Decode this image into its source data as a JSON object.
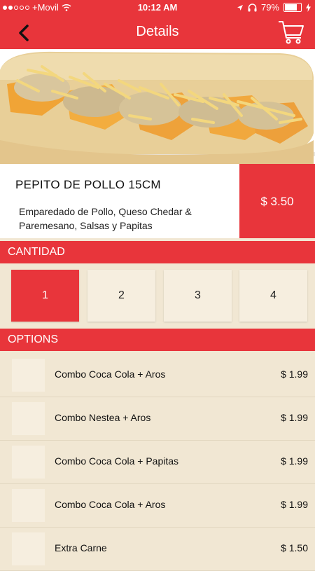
{
  "status_bar": {
    "carrier": "+Movil",
    "time": "10:12 AM",
    "battery": "79%",
    "battery_level": 0.79
  },
  "nav": {
    "title": "Details",
    "back_icon": "chevron-left-icon",
    "cart_icon": "cart-icon"
  },
  "product": {
    "name": "PEPITO DE POLLO 15CM",
    "description": "Emparedado de Pollo, Queso Chedar & Paremesano, Salsas y Papitas",
    "price": "$ 3.50"
  },
  "quantity": {
    "header": "CANTIDAD",
    "options": [
      "1",
      "2",
      "3",
      "4"
    ],
    "selected": "1"
  },
  "options_section": {
    "header": "OPTIONS",
    "items": [
      {
        "name": "Combo Coca Cola + Aros",
        "price": "$ 1.99"
      },
      {
        "name": "Combo Nestea + Aros",
        "price": "$ 1.99"
      },
      {
        "name": "Combo Coca Cola + Papitas",
        "price": "$ 1.99"
      },
      {
        "name": "Combo Coca Cola + Aros",
        "price": "$ 1.99"
      },
      {
        "name": "Extra Carne",
        "price": "$ 1.50"
      }
    ]
  },
  "colors": {
    "accent": "#e8353b",
    "background": "#f1e7d3",
    "tile": "#f6eedf"
  }
}
